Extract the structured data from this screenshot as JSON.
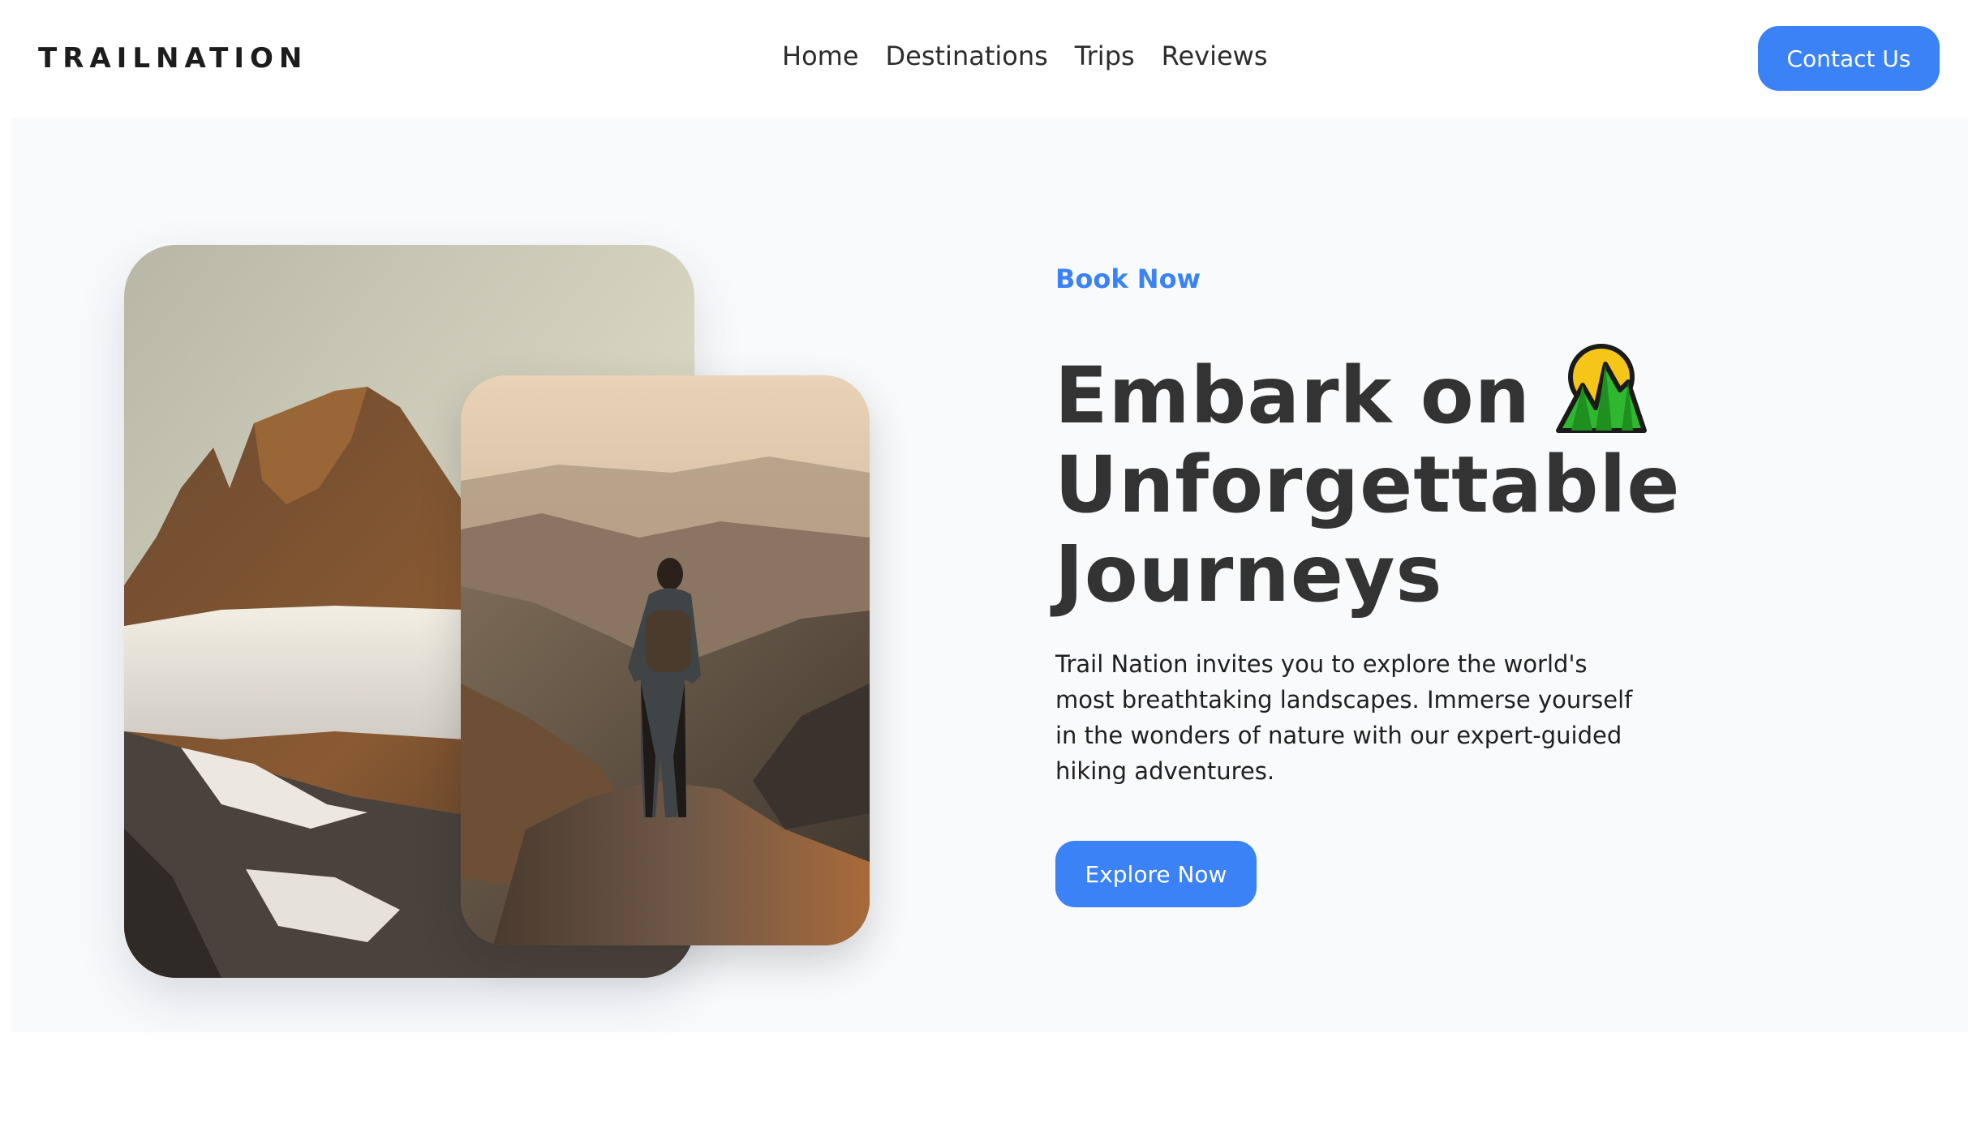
{
  "brand": {
    "logo_text": "TRAILNATION"
  },
  "nav": {
    "links": [
      {
        "label": "Home"
      },
      {
        "label": "Destinations"
      },
      {
        "label": "Trips"
      },
      {
        "label": "Reviews"
      }
    ],
    "contact_label": "Contact Us"
  },
  "hero": {
    "eyebrow": "Book Now",
    "headline_lines": [
      "Embark on",
      "Unforgettable",
      "Journeys"
    ],
    "headline_icon": "mountain-sunrise-icon",
    "description": "Trail Nation invites you to explore the world's most breathtaking landscapes. Immerse yourself in the wonders of nature with our expert-guided hiking adventures.",
    "cta_label": "Explore Now"
  },
  "colors": {
    "accent": "#3b82f6",
    "hero_background": "#f9fafc",
    "heading": "#333333"
  }
}
